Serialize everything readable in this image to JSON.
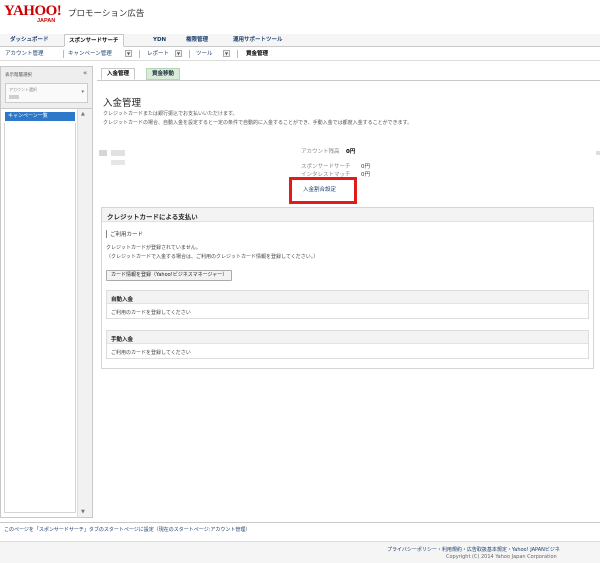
{
  "header": {
    "logo": "YAHOO!",
    "logo_sub": "JAPAN",
    "service_name": "プロモーション広告"
  },
  "main_tabs": [
    {
      "label": "ダッシュボード"
    },
    {
      "label": "スポンサードサーチ",
      "active": true
    },
    {
      "label": "YDN"
    },
    {
      "label": "権限管理"
    },
    {
      "label": "運用サポートツール"
    }
  ],
  "sub_nav": {
    "account": "アカウント管理",
    "campaign": "キャンペーン管理",
    "report": "レポート",
    "tool": "ツール",
    "funds": "資金管理"
  },
  "sidebar": {
    "title": "表示階層選択",
    "collapse_icon": "«",
    "account_label": "アカウント選択",
    "campaign_item": "キャンペーン一覧"
  },
  "content_tabs": [
    {
      "label": "入金管理",
      "active": true
    },
    {
      "label": "資金移動"
    }
  ],
  "page": {
    "title": "入金管理",
    "desc_line1": "クレジットカードまたは銀行振込でお支払いいただけます。",
    "desc_line2": "クレジットカードの場合、自動入金を設定すると一定の条件で自動的に入金することができ、手動入金では都度入金することができます。"
  },
  "balance": {
    "account_balance_label": "アカウント残高",
    "account_balance_value": "0円",
    "sponsored_search_label": "スポンサードサーチ",
    "sponsored_search_value": "0円",
    "interest_match_label": "インタレストマッチ",
    "interest_match_value": "0円",
    "deposit_allocation_link": "入金割合設定"
  },
  "credit_card": {
    "title": "クレジットカードによる支払い",
    "used_card_label": "ご利用カード",
    "not_registered": "クレジットカードが登録されていません。",
    "register_note": "（クレジットカードで入金する場合は、ご利用のクレジットカード情報を登録してください。）",
    "register_button": "カード情報を登録（Yahoo!ビジネスマネージャー）",
    "auto_deposit_title": "自動入金",
    "auto_deposit_msg": "ご利用のカードを登録してください",
    "manual_deposit_title": "手動入金",
    "manual_deposit_msg": "ご利用のカードを登録してください"
  },
  "footer": {
    "start_page": "このページを「スポンサードサーチ」タブのスタートページに設定（現在のスタートページ:アカウント管理）",
    "links": "プライバシーポリシー・利用規約・広告取扱基本規定・Yahoo! JAPANビジネ",
    "copyright": "Copyright (C) 2014 Yahoo Japan Corporation"
  }
}
